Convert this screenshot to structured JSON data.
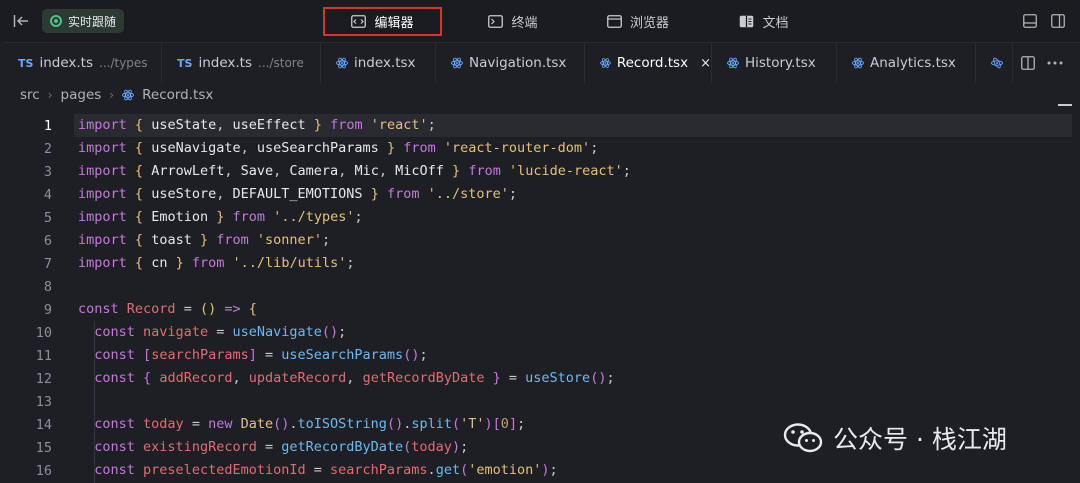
{
  "topbar": {
    "live_label": "实时跟随",
    "modes": [
      {
        "label": "编辑器",
        "icon": "code-icon",
        "active": true
      },
      {
        "label": "终端",
        "icon": "terminal-icon",
        "active": false
      },
      {
        "label": "浏览器",
        "icon": "browser-icon",
        "active": false
      },
      {
        "label": "文档",
        "icon": "document-icon",
        "active": false
      }
    ]
  },
  "tabs": [
    {
      "type": "TS",
      "label": "index.ts",
      "sub": ".../types"
    },
    {
      "type": "TS",
      "label": "index.ts",
      "sub": ".../store"
    },
    {
      "type": "react",
      "label": "index.tsx",
      "sub": ""
    },
    {
      "type": "react",
      "label": "Navigation.tsx",
      "sub": ""
    },
    {
      "type": "react",
      "label": "Record.tsx",
      "sub": "",
      "active": true
    },
    {
      "type": "react",
      "label": "History.tsx",
      "sub": ""
    },
    {
      "type": "react",
      "label": "Analytics.tsx",
      "sub": ""
    }
  ],
  "close_glyph": "×",
  "breadcrumb": {
    "part1": "src",
    "part2": "pages",
    "file": "Record.tsx"
  },
  "current_line": 1,
  "line_numbers": [
    "1",
    "2",
    "3",
    "4",
    "5",
    "6",
    "7",
    "8",
    "9",
    "10",
    "11",
    "12",
    "13",
    "14",
    "15",
    "16"
  ],
  "watermark": {
    "text": "公众号 · 栈江湖"
  },
  "colors": {
    "accent_red": "#d9342b",
    "keyword": "#c678dd",
    "string": "#e5c07b",
    "function": "#6fb8f0"
  }
}
